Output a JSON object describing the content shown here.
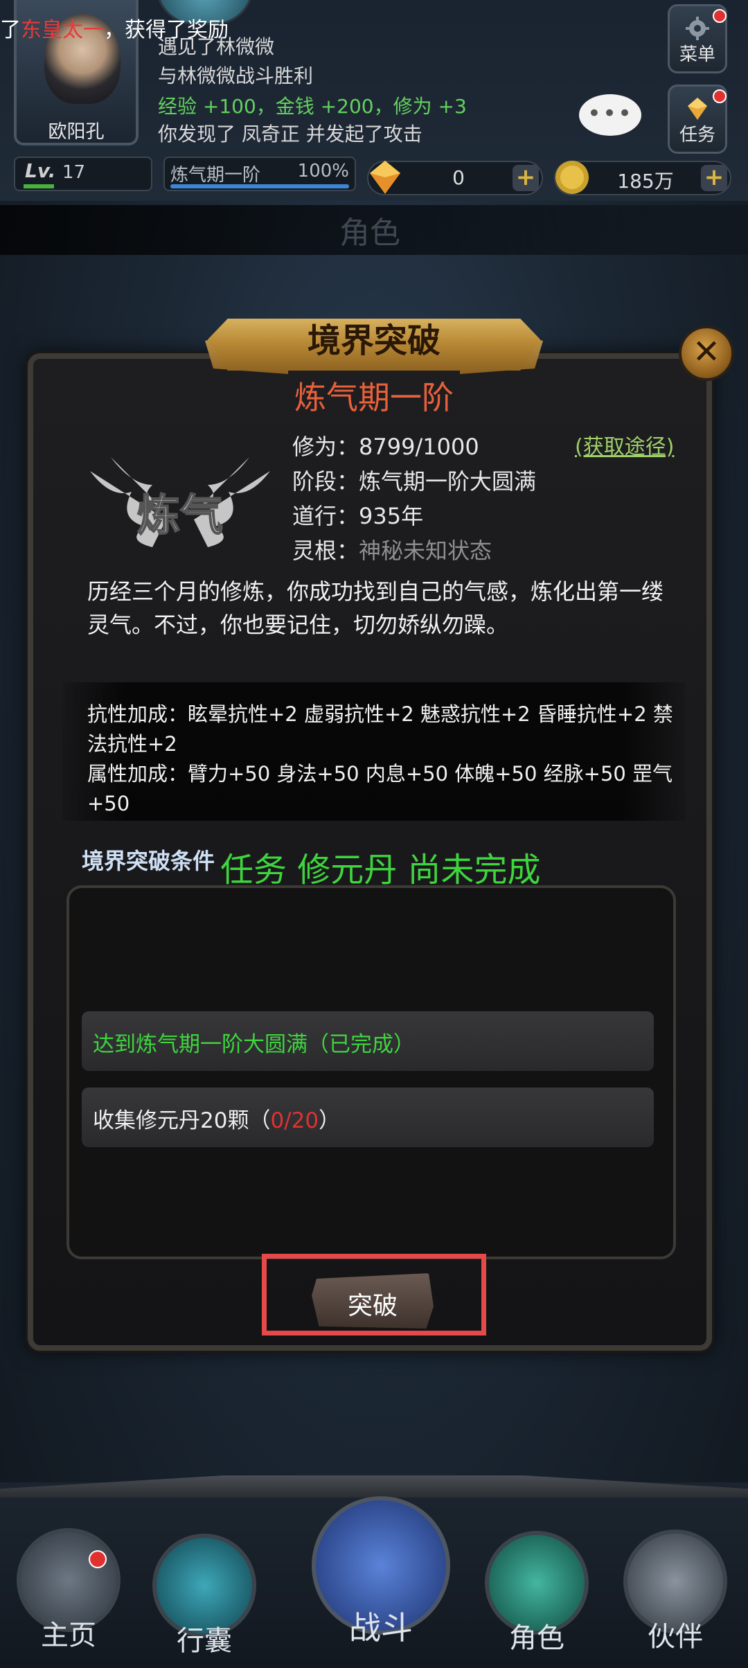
{
  "hud": {
    "player_name": "欧阳孔",
    "log_lines": [
      "",
      "遇见了林微微",
      "与林微微战斗胜利",
      "经验 +100，金钱 +200，修为 +3",
      "你发现了 凤奇正 并发起了攻击"
    ],
    "menu_label": "菜单",
    "task_label": "任务",
    "chat_dots": "•••",
    "level_prefix": "Lv.",
    "level": "17",
    "realm_name": "炼气期一阶",
    "realm_percent": "100%",
    "realm_progress": 1.0,
    "gems": "0",
    "coins": "185万",
    "plus": "+"
  },
  "notice": {
    "prefix": "了",
    "name": "东皇太一",
    "suffix": "，获得了奖励"
  },
  "background_title": "角色",
  "dialog": {
    "title": "境界突破",
    "realm_title": "炼气期一阶",
    "emblem_text": "炼气",
    "cultivation_label": "修为：",
    "cultivation_value": "8799/1000",
    "acquire_link": "(获取途径)",
    "stage_label": "阶段：",
    "stage_value": "炼气期一阶大圆满",
    "dao_label": "道行：",
    "dao_value": "935年",
    "root_label": "灵根：",
    "root_value": "神秘未知状态",
    "description": "历经三个月的修炼，你成功找到自己的气感，炼化出第一缕灵气。不过，你也要记住，切勿娇纵勿躁。",
    "resist_bonus": "抗性加成：眩晕抗性+2 虚弱抗性+2 魅惑抗性+2 昏睡抗性+2 禁法抗性+2",
    "attr_bonus": "属性加成：臂力+50 身法+50 内息+50 体魄+50 经脉+50 罡气+50",
    "conditions_heading": "境界突破条件",
    "warning": "任务 修元丹 尚未完成",
    "conditions": [
      {
        "text": "达到炼气期一阶大圆满（已完成）",
        "done": true
      },
      {
        "text_before": "收集修元丹20颗（",
        "progress": "0/20",
        "text_after": "）",
        "done": false
      }
    ],
    "breakthrough_button": "突破"
  },
  "nav": {
    "home": "主页",
    "bag": "行囊",
    "battle": "战斗",
    "role": "角色",
    "partner": "伙伴"
  },
  "colors": {
    "accent_gold": "#d8a34a",
    "realm_orange": "#e7603a",
    "success_green": "#3ed53e",
    "alert_red": "#e03131",
    "highlight_red": "#e5494a"
  }
}
